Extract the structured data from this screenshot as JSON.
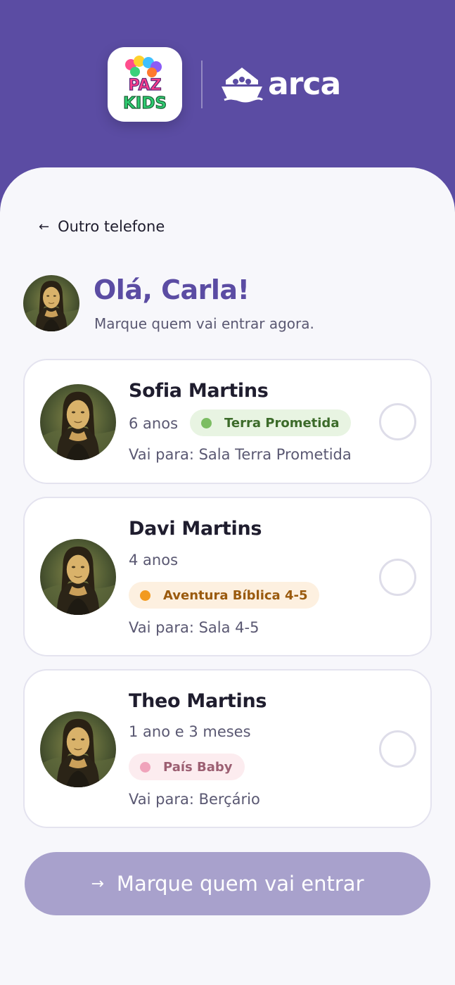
{
  "brand": {
    "logo_primary": "PAZ KIDS",
    "logo_secondary": "arca"
  },
  "nav": {
    "back_label": "Outro telefone"
  },
  "greeting": {
    "title": "Olá, Carla!",
    "subtitle": "Marque quem vai entrar agora."
  },
  "children": [
    {
      "name": "Sofia Martins",
      "age": "6 anos",
      "group": "Terra Prometida",
      "destination": "Vai para: Sala Terra Prometida",
      "badge_bg": "#e8f4e2",
      "badge_dot": "#7cbd63",
      "badge_text": "#3c6b2a",
      "selected": false
    },
    {
      "name": "Davi Martins",
      "age": "4 anos",
      "group": "Aventura Bíblica 4-5",
      "destination": "Vai para: Sala 4-5",
      "badge_bg": "#fdf0e0",
      "badge_dot": "#f29a1f",
      "badge_text": "#9a5a0e",
      "selected": false
    },
    {
      "name": "Theo Martins",
      "age": "1 ano e 3 meses",
      "group": "País Baby",
      "destination": "Vai para: Berçário",
      "badge_bg": "#fcecef",
      "badge_dot": "#f0a3bb",
      "badge_text": "#9c5f72",
      "selected": false
    }
  ],
  "cta": {
    "label": "Marque quem vai entrar",
    "enabled": false
  },
  "colors": {
    "primary": "#5b4ca3",
    "cta_disabled": "#a8a1cc",
    "background": "#f7f7fb"
  }
}
